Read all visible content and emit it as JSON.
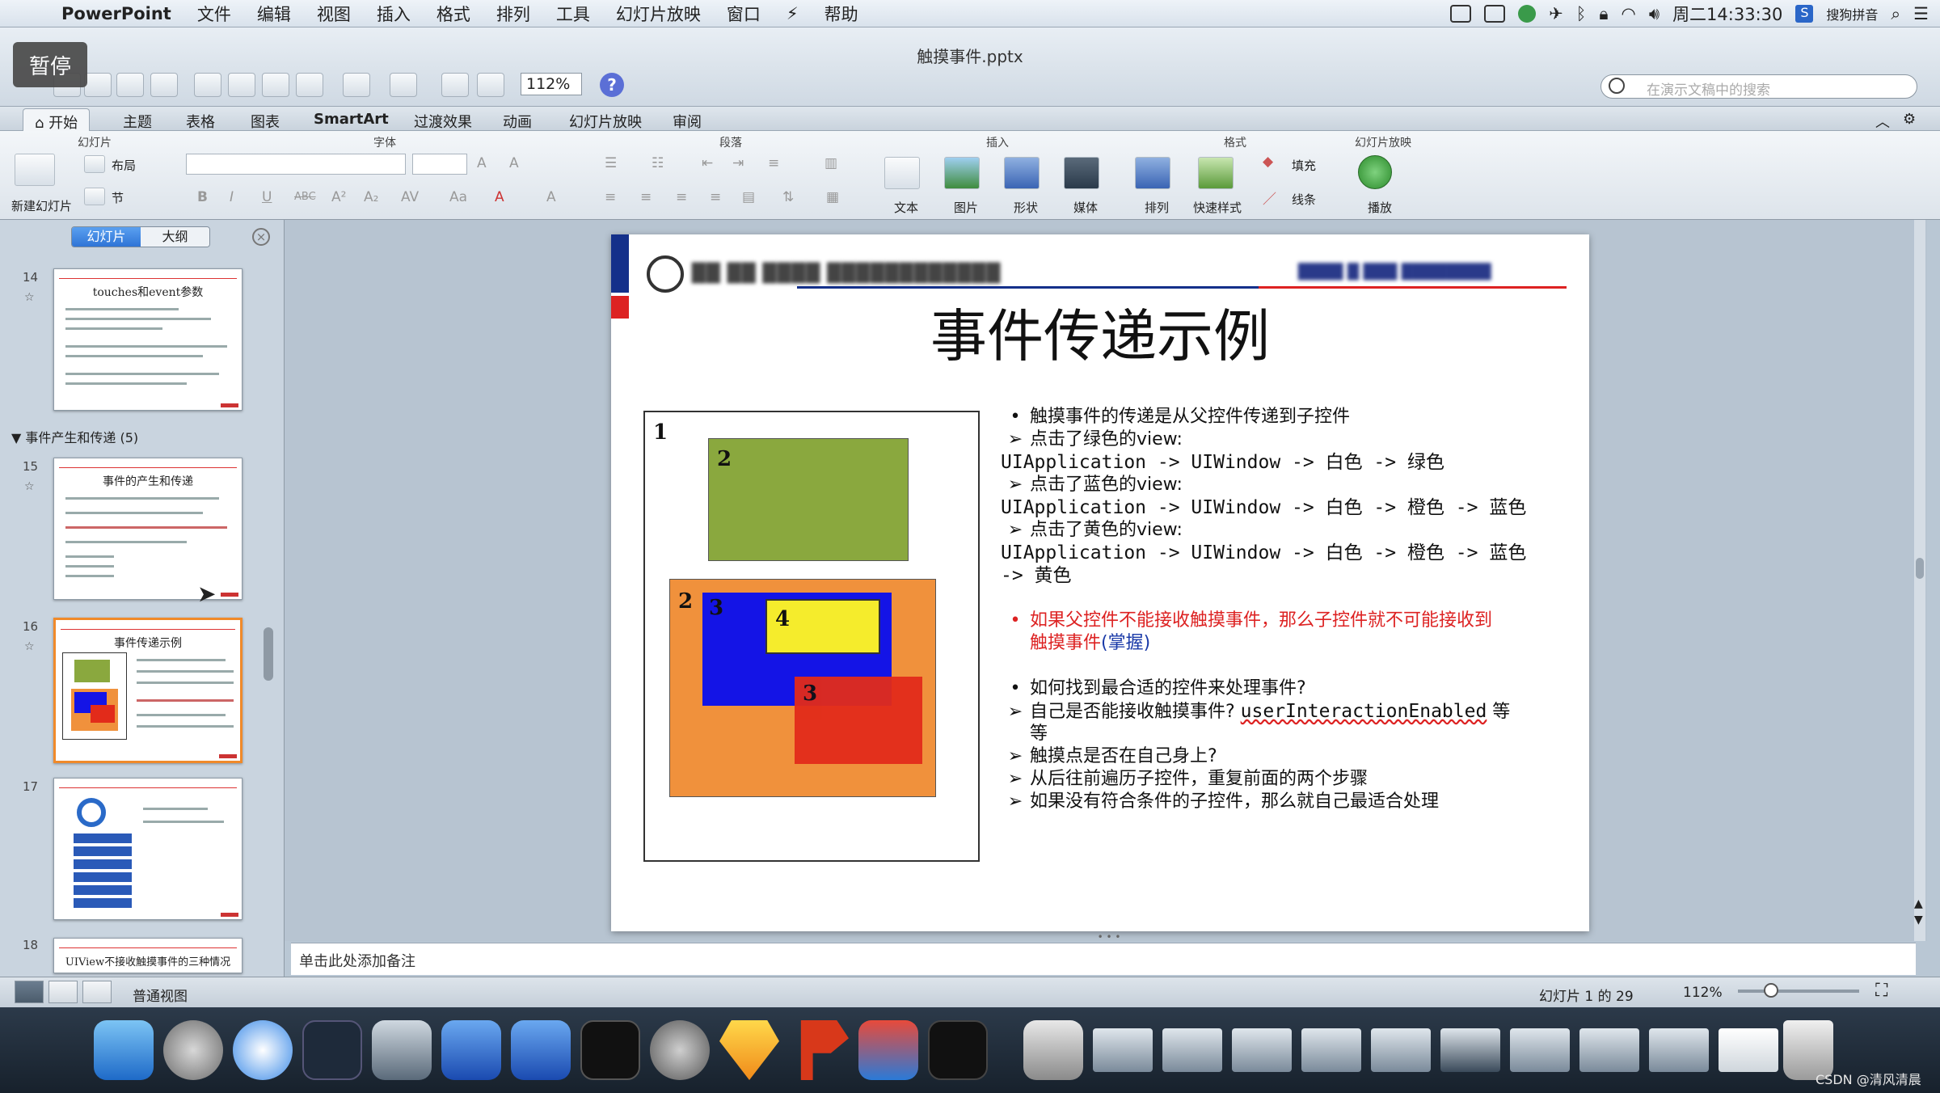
{
  "menubar": {
    "app": "PowerPoint",
    "items": [
      "文件",
      "编辑",
      "视图",
      "插入",
      "格式",
      "排列",
      "工具",
      "幻灯片放映",
      "窗口",
      "帮助"
    ],
    "clock": "周二14:33:30",
    "input_method": "搜狗拼音"
  },
  "overlay": {
    "pause_label": "暂停"
  },
  "toolbar": {
    "doc_title": "触摸事件.pptx",
    "zoom": "112%",
    "search_placeholder": "在演示文稿中的搜索"
  },
  "ribbon": {
    "tabs": [
      "开始",
      "主题",
      "表格",
      "图表",
      "SmartArt",
      "过渡效果",
      "动画",
      "幻灯片放映",
      "审阅"
    ],
    "groups": {
      "slides": "幻灯片",
      "font": "字体",
      "paragraph": "段落",
      "insert": "插入",
      "format": "格式",
      "slideshow": "幻灯片放映"
    },
    "labels": {
      "new_slide": "新建幻灯片",
      "layout": "布局",
      "section": "节",
      "text": "文本",
      "picture": "图片",
      "shape": "形状",
      "media": "媒体",
      "arrange": "排列",
      "quick_styles": "快速样式",
      "fill": "填充",
      "line": "线条",
      "play": "播放"
    }
  },
  "left_panel": {
    "tab_slides": "幻灯片",
    "tab_outline": "大纲",
    "section_header": "▼ 事件产生和传递 (5)",
    "thumbs": [
      {
        "num": "14",
        "title": "touches和event参数"
      },
      {
        "num": "15",
        "title": "事件的产生和传递"
      },
      {
        "num": "16",
        "title": "事件传递示例"
      },
      {
        "num": "17",
        "title": ""
      },
      {
        "num": "18",
        "title": "UIView不接收触摸事件的三种情况"
      }
    ]
  },
  "slide": {
    "title": "事件传递示例",
    "diagram_labels": {
      "l1": "1",
      "l2a": "2",
      "l2b": "2",
      "l3a": "3",
      "l4": "4",
      "l3b": "3"
    },
    "colors": {
      "green": "#8aa83e",
      "orange": "#f0913c",
      "blue": "#1414e6",
      "yellow": "#f5ec2c",
      "red": "#e22b1a",
      "header_blue": "#14308a"
    },
    "bullets": {
      "b1": "触摸事件的传递是从父控件传递到子控件",
      "a1": "点击了绿色的view:",
      "p1": "UIApplication -> UIWindow -> 白色 -> 绿色",
      "a2": "点击了蓝色的view:",
      "p2": "UIApplication -> UIWindow -> 白色 -> 橙色 -> 蓝色",
      "a3": "点击了黄色的view:",
      "p3a": "UIApplication -> UIWindow -> 白色 -> 橙色 -> 蓝色",
      "p3b": "-> 黄色",
      "r1a": "如果父控件不能接收触摸事件，那么子控件就不可能接收到",
      "r1b": "触摸事件",
      "r1c": "(掌握)",
      "b2": "如何找到最合适的控件来处理事件?",
      "a4": "自己是否能接收触摸事件? ",
      "a4code": "userInteractionEnabled",
      "a4tail": " 等",
      "a4wrap": "等",
      "a5": "触摸点是否在自己身上?",
      "a6": "从后往前遍历子控件，重复前面的两个步骤",
      "a7": "如果没有符合条件的子控件，那么就自己最适合处理"
    }
  },
  "notes": {
    "placeholder": "单击此处添加备注"
  },
  "statusbar": {
    "view": "普通视图",
    "slide_pos": "幻灯片 1 的 29",
    "zoom": "112%"
  },
  "dock": {
    "watermark": "CSDN @清风清晨"
  }
}
